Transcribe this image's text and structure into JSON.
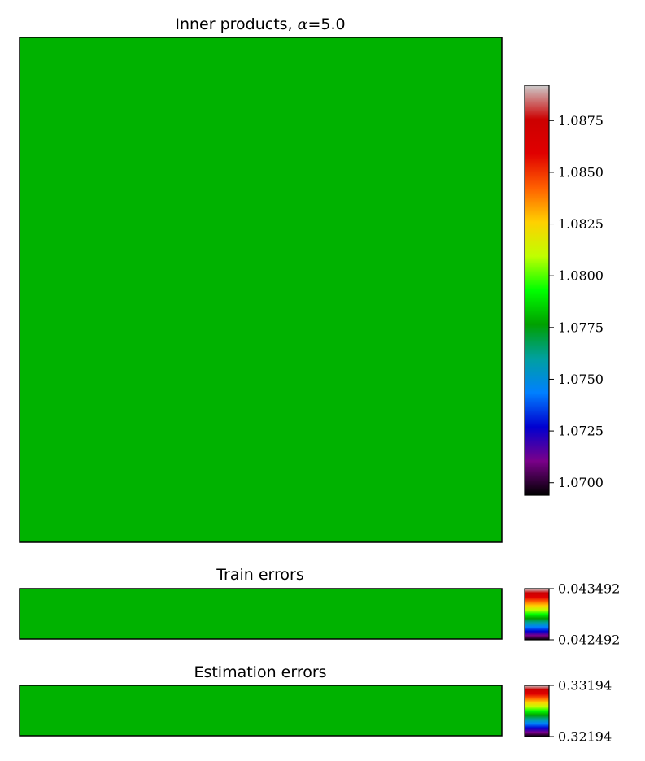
{
  "chart_data": [
    {
      "type": "heatmap",
      "title_prefix": "Inner products, ",
      "title_symbol": "α",
      "title_value": "=5.0",
      "cell_color": "#00b200",
      "colorbar": {
        "vmin": 1.0694,
        "vmax": 1.0892,
        "ticks": [
          {
            "value": 1.07,
            "label": "1.0700"
          },
          {
            "value": 1.0725,
            "label": "1.0725"
          },
          {
            "value": 1.075,
            "label": "1.0750"
          },
          {
            "value": 1.0775,
            "label": "1.0775"
          },
          {
            "value": 1.08,
            "label": "1.0800"
          },
          {
            "value": 1.0825,
            "label": "1.0825"
          },
          {
            "value": 1.085,
            "label": "1.0850"
          },
          {
            "value": 1.0875,
            "label": "1.0875"
          }
        ]
      }
    },
    {
      "type": "heatmap",
      "title": "Train errors",
      "cell_color": "#00b200",
      "colorbar": {
        "vmin": 0.042492,
        "vmax": 0.043492,
        "ticks": [
          {
            "value": 0.042492,
            "label": "0.042492"
          },
          {
            "value": 0.043492,
            "label": "0.043492"
          }
        ]
      }
    },
    {
      "type": "heatmap",
      "title": "Estimation errors",
      "cell_color": "#00b200",
      "colorbar": {
        "vmin": 0.32194,
        "vmax": 0.33194,
        "ticks": [
          {
            "value": 0.32194,
            "label": "0.32194"
          },
          {
            "value": 0.33194,
            "label": "0.33194"
          }
        ]
      }
    }
  ],
  "colormap": [
    "#000000",
    "#7a008a",
    "#0000d0",
    "#0080ff",
    "#00a0a0",
    "#00a000",
    "#00ff00",
    "#c0ff00",
    "#ffd000",
    "#ff6000",
    "#e00000",
    "#cc0000",
    "#cccccc"
  ]
}
